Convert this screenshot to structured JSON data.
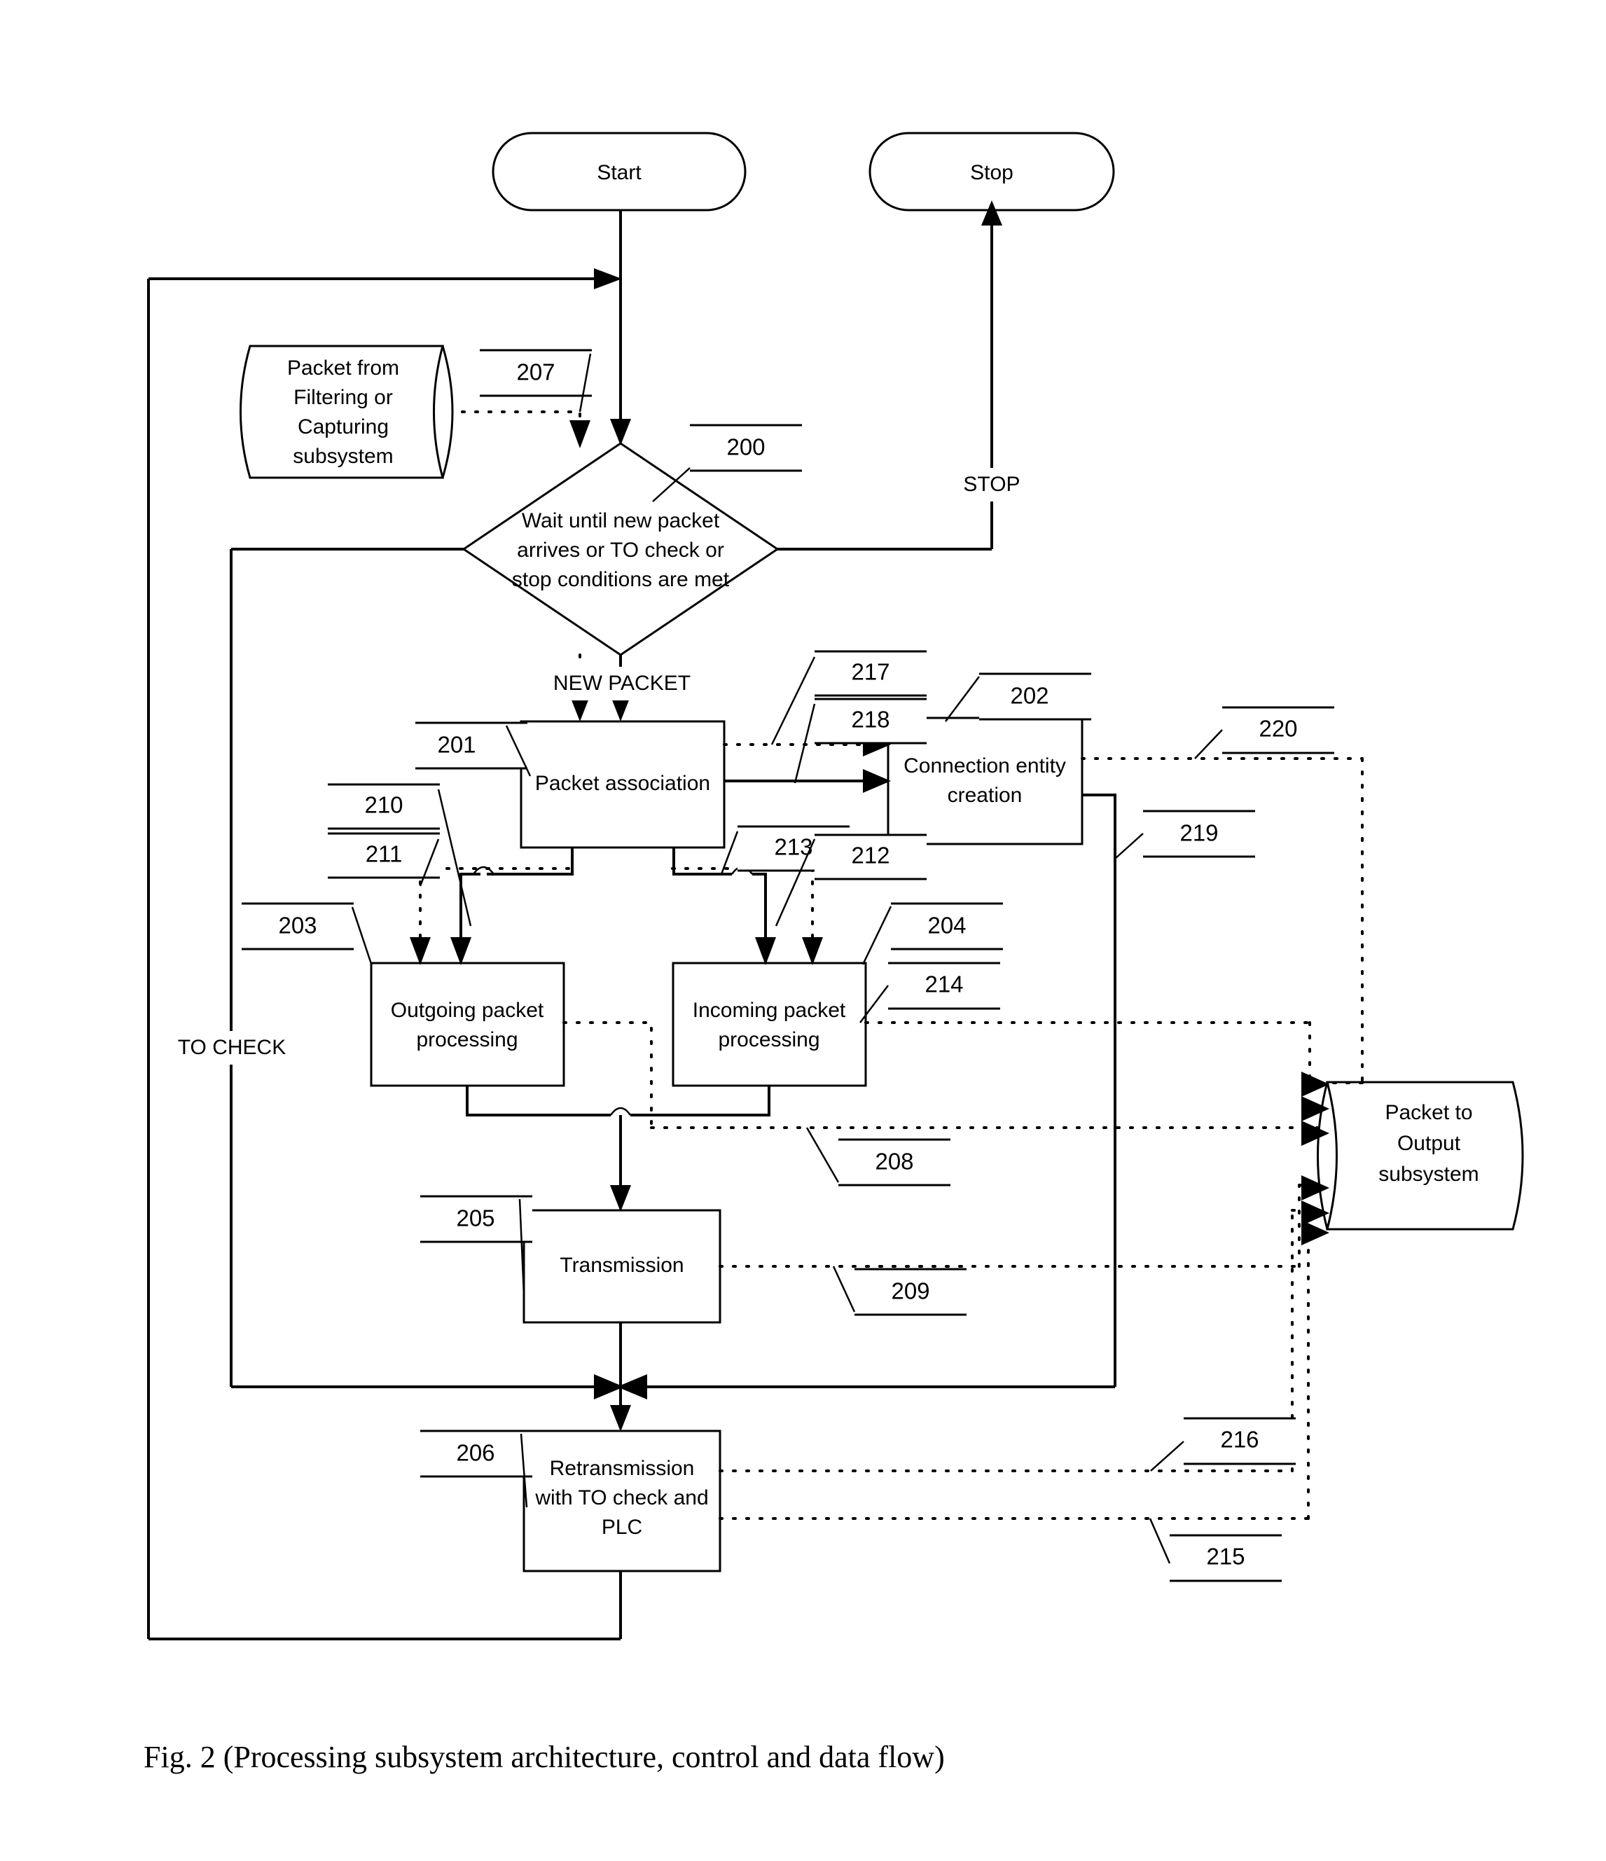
{
  "figure": {
    "caption": "Fig. 2 (Processing subsystem architecture, control and data flow)"
  },
  "nodes": {
    "start": {
      "label": "Start",
      "shape": "stadium"
    },
    "stop": {
      "label": "Stop",
      "shape": "stadium"
    },
    "input_store": {
      "label_lines": [
        "Packet from",
        "Filtering or",
        "Capturing",
        "subsystem"
      ],
      "shape": "cylinder"
    },
    "output_store": {
      "label_lines": [
        "Packet to",
        "Output",
        "subsystem"
      ],
      "shape": "cylinder"
    },
    "decision": {
      "label_lines": [
        "Wait until new packet",
        "arrives or TO check or",
        "stop conditions are met"
      ],
      "shape": "diamond",
      "ref": "200"
    },
    "packet_association": {
      "label_lines": [
        "Packet association"
      ],
      "shape": "process",
      "ref": "201"
    },
    "connection_entity_creation": {
      "label_lines": [
        "Connection entity",
        "creation"
      ],
      "shape": "process",
      "ref": "202"
    },
    "outgoing_packet_processing": {
      "label_lines": [
        "Outgoing packet",
        "processing"
      ],
      "shape": "process",
      "ref": "203"
    },
    "incoming_packet_processing": {
      "label_lines": [
        "Incoming packet",
        "processing"
      ],
      "shape": "process",
      "ref": "204"
    },
    "transmission": {
      "label_lines": [
        "Transmission"
      ],
      "shape": "process",
      "ref": "205"
    },
    "retransmission": {
      "label_lines": [
        "Retransmission",
        "with TO check and",
        "PLC"
      ],
      "shape": "process",
      "ref": "206"
    }
  },
  "flow_labels": {
    "stop_branch": "STOP",
    "new_packet_branch": "NEW PACKET",
    "to_check_branch": "TO CHECK"
  },
  "reference_numerals": {
    "n200": "200",
    "n201": "201",
    "n202": "202",
    "n203": "203",
    "n204": "204",
    "n205": "205",
    "n206": "206",
    "n207": "207",
    "n208": "208",
    "n209": "209",
    "n210": "210",
    "n211": "211",
    "n212": "212",
    "n213": "213",
    "n214": "214",
    "n215": "215",
    "n216": "216",
    "n217": "217",
    "n218": "218",
    "n219": "219",
    "n220": "220"
  },
  "colors": {
    "ink": "#000000",
    "paper": "#ffffff"
  }
}
